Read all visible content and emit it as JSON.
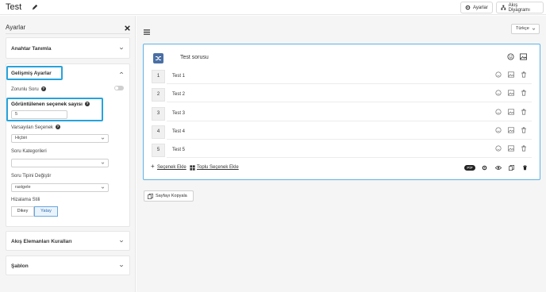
{
  "header": {
    "title": "Test",
    "settings_label": "Ayarlar",
    "flow_label": "Akış Diyagramı"
  },
  "sidebar": {
    "title": "Ayarlar",
    "sections": {
      "keys": "Anahtar Tanımla",
      "advanced": "Gelişmiş Ayarlar",
      "flow_rules": "Akış Elemanları Kuralları",
      "template": "Şablon"
    },
    "advanced": {
      "required_label": "Zorunlu Soru",
      "visible_count_label": "Görüntülenen seçenek sayısı",
      "visible_count_value": "5",
      "default_option_label": "Varsayılan Seçenek",
      "default_option_value": "Hiçbiri",
      "category_label": "Soru Kategorileri",
      "category_value": "",
      "type_label": "Soru Tipini Değiştir",
      "type_value": "rastgele",
      "alignment_label": "Hizalama Stili",
      "alignment_vertical": "Dikey",
      "alignment_horizontal": "Yatay"
    }
  },
  "main": {
    "language": "Türkçe",
    "question_title": "Test sorusu",
    "options": [
      {
        "num": "1",
        "label": "Test 1"
      },
      {
        "num": "2",
        "label": "Test 2"
      },
      {
        "num": "3",
        "label": "Test 3"
      },
      {
        "num": "4",
        "label": "Test 4"
      },
      {
        "num": "5",
        "label": "Test 5"
      }
    ],
    "add_option": "Seçenek Ekle",
    "bulk_add_option": "Toplu Seçenek Ekle",
    "pill_label": "PİP",
    "copy_page": "Sayfayı Kopyala"
  },
  "colors": {
    "highlight": "#27a3dc",
    "question_border": "#5db3e6",
    "question_icon": "#4a6fa5"
  }
}
